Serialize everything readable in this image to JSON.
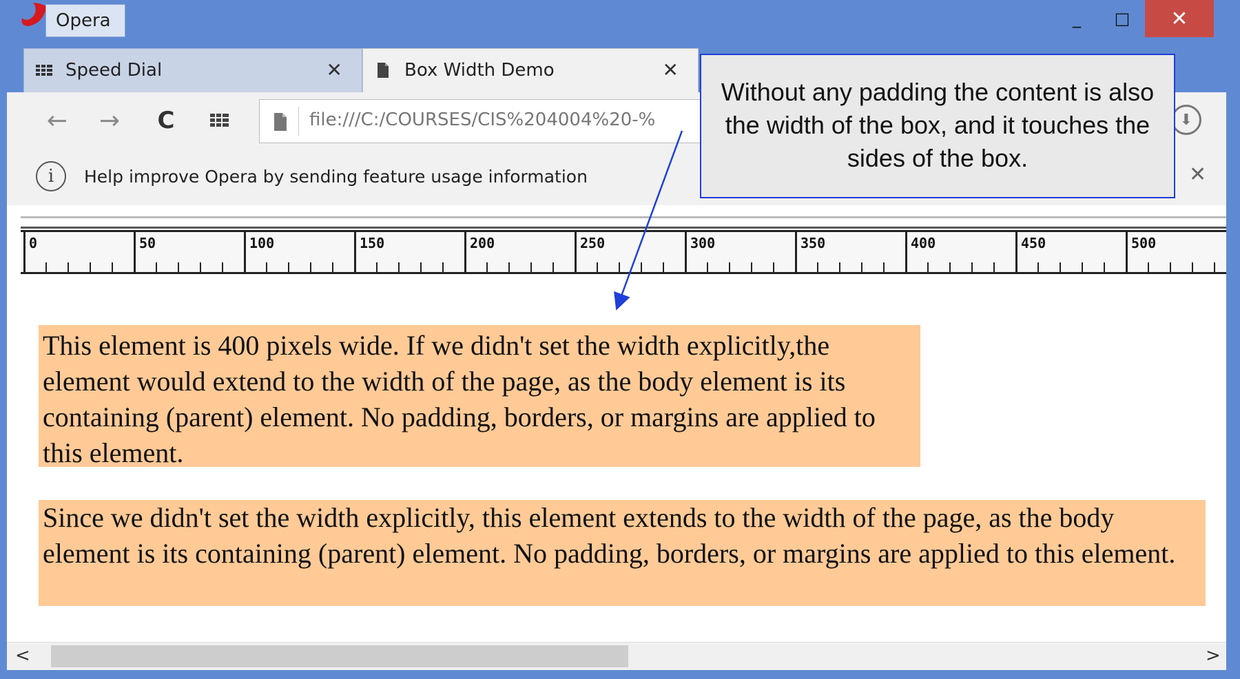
{
  "window": {
    "app_title": "Opera",
    "controls": {
      "minimize": "_",
      "maximize": "□",
      "close": "✕"
    }
  },
  "tabs": [
    {
      "label": "Speed Dial",
      "icon": "speed-dial-grid-icon",
      "close": "✕",
      "active": false
    },
    {
      "label": "Box Width Demo",
      "icon": "page-icon",
      "close": "✕",
      "active": true
    }
  ],
  "toolbar": {
    "back": "←",
    "forward": "→",
    "reload": "C",
    "url": "file:///C:/COURSES/CIS%204004%20-%"
  },
  "infobar": {
    "icon_glyph": "i",
    "message": "Help improve Opera by sending feature usage information",
    "close": "✕"
  },
  "ruler": {
    "labels": [
      "0",
      "50",
      "100",
      "150",
      "200",
      "250",
      "300",
      "350",
      "400",
      "450",
      "500"
    ]
  },
  "content": {
    "box1_text": "This element is 400 pixels wide. If we didn't set the width explicitly,the element would extend to the width of the page, as the body element is its containing (parent) element. No padding, borders, or margins are applied to this element.",
    "box2_text": "Since we didn't set the width explicitly, this element extends to the width of the page, as the body element is its containing (parent) element. No padding, borders, or margins are applied to this element."
  },
  "callout": {
    "text": "Without any padding the content is also the width of the box, and it touches the sides of the box."
  },
  "scrollbar": {
    "left": "<",
    "right": ">"
  },
  "colors": {
    "window_frame": "#5f8ad3",
    "box_fill": "#ffca96",
    "callout_border": "#1f3fd9",
    "close_button": "#c84a45"
  }
}
